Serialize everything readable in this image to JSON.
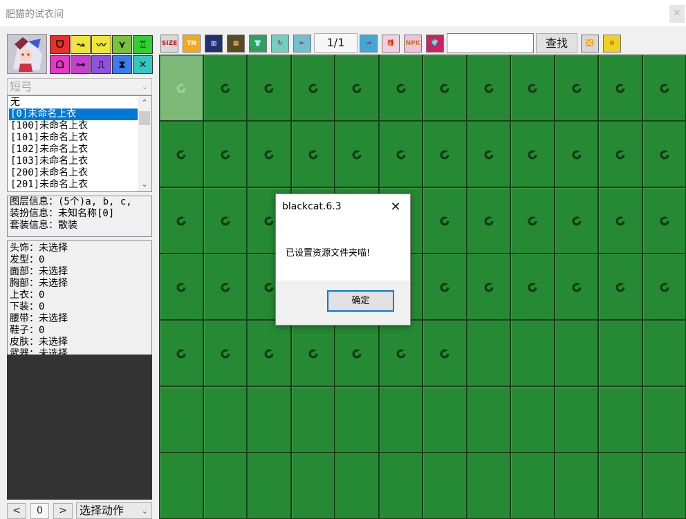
{
  "window": {
    "title": "肥猫的试衣间",
    "close_label": "✕"
  },
  "left": {
    "category_buttons": [
      {
        "name": "category-horn-icon",
        "glyph": "ᗜ",
        "color": "#e8302a"
      },
      {
        "name": "category-tail-icon",
        "glyph": "↝",
        "color": "#f0e63a"
      },
      {
        "name": "category-mask-icon",
        "glyph": "〰",
        "color": "#f0e63a"
      },
      {
        "name": "category-wings-icon",
        "glyph": "⋎",
        "color": "#7ac23c"
      },
      {
        "name": "category-belt-icon",
        "glyph": "♖",
        "color": "#2fd030"
      },
      {
        "name": "category-helmet-icon",
        "glyph": "ᗝ",
        "color": "#e838c8"
      },
      {
        "name": "category-band-icon",
        "glyph": "⊶",
        "color": "#c840d0"
      },
      {
        "name": "category-rack-icon",
        "glyph": "⎍",
        "color": "#9050e0"
      },
      {
        "name": "category-figure-icon",
        "glyph": "⧗",
        "color": "#3c7cf0"
      },
      {
        "name": "category-cross-icon",
        "glyph": "✕",
        "color": "#30c8c0"
      }
    ],
    "part_select": {
      "value": "短弓"
    },
    "list_items": [
      "无",
      "[0]未命名上衣",
      "[100]未命名上衣",
      "[101]未命名上衣",
      "[102]未命名上衣",
      "[103]未命名上衣",
      "[200]未命名上衣",
      "[201]未命名上衣"
    ],
    "selected_index": 1,
    "info_lines": [
      "图层信息：(5个)a, b, c,",
      "装扮信息：未知名称[0]",
      "套装信息：散装"
    ],
    "slot_lines": [
      "头饰：未选择",
      "发型：0",
      "面部：未选择",
      "胸部：未选择",
      "上衣：0",
      "下装：0",
      "腰带：未选择",
      "鞋子：0",
      "皮肤：未选择",
      "武器：未选择"
    ],
    "frame": {
      "prev_label": "<",
      "index": "0",
      "next_label": ">"
    },
    "action_select": {
      "value": "选择动作"
    }
  },
  "toolbar": {
    "tools": [
      {
        "name": "size-tool-icon",
        "text": "SIZE",
        "bg": "#d8d8d8",
        "fg": "#c02020"
      },
      {
        "name": "tn-tool-icon",
        "text": "TN",
        "bg": "#f8a81c",
        "fg": "#ffffff"
      },
      {
        "name": "layout-tool-icon",
        "text": "▥",
        "bg": "#203070",
        "fg": "#ffffff"
      },
      {
        "name": "film-tool-icon",
        "text": "▦",
        "bg": "#5a4a20",
        "fg": "#e8d070"
      },
      {
        "name": "shirt-tool-icon",
        "text": "👕",
        "bg": "#30a060",
        "fg": "#ffffff"
      },
      {
        "name": "refresh-tool-icon",
        "text": "↻",
        "bg": "#70d0c0",
        "fg": "#c02020"
      },
      {
        "name": "import-tool-icon",
        "text": "⇤",
        "bg": "#70c0d0",
        "fg": "#c02020"
      },
      {
        "name": "export-tool-icon",
        "text": "⇥",
        "bg": "#40a8d8",
        "fg": "#c02020"
      },
      {
        "name": "gift-tool-icon",
        "text": "🎁",
        "bg": "#f0d0e0",
        "fg": "#d02050"
      },
      {
        "name": "npk-tool-icon",
        "text": "NPK",
        "bg": "#f0c0e0",
        "fg": "#c08000"
      },
      {
        "name": "globe-tool-icon",
        "text": "🌍",
        "bg": "#d02060",
        "fg": "#ffffff"
      },
      {
        "name": "shuffle-tool-icon",
        "text": "🔀",
        "bg": "#d8d8d8",
        "fg": "#e03060"
      },
      {
        "name": "settings-tool-icon",
        "text": "⚙",
        "bg": "#f0d020",
        "fg": "#806000"
      }
    ],
    "page": "1/1",
    "search_value": "",
    "find_label": "查找"
  },
  "grid": {
    "cols": 12,
    "rows": 7,
    "filled_cells": 55,
    "dim_first": true
  },
  "dialog": {
    "title": "blackcat.6.3",
    "close_label": "✕",
    "message": "已设置资源文件夹喵!",
    "ok_label": "确定"
  }
}
